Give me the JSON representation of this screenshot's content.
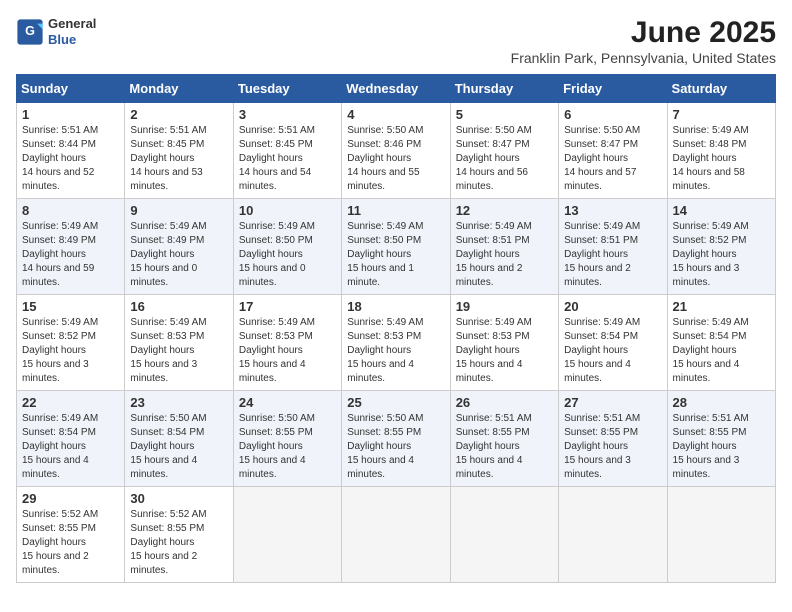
{
  "header": {
    "logo_general": "General",
    "logo_blue": "Blue",
    "month": "June 2025",
    "location": "Franklin Park, Pennsylvania, United States"
  },
  "days_of_week": [
    "Sunday",
    "Monday",
    "Tuesday",
    "Wednesday",
    "Thursday",
    "Friday",
    "Saturday"
  ],
  "weeks": [
    [
      {
        "day": "1",
        "sunrise": "5:51 AM",
        "sunset": "8:44 PM",
        "daylight": "14 hours and 52 minutes."
      },
      {
        "day": "2",
        "sunrise": "5:51 AM",
        "sunset": "8:45 PM",
        "daylight": "14 hours and 53 minutes."
      },
      {
        "day": "3",
        "sunrise": "5:51 AM",
        "sunset": "8:45 PM",
        "daylight": "14 hours and 54 minutes."
      },
      {
        "day": "4",
        "sunrise": "5:50 AM",
        "sunset": "8:46 PM",
        "daylight": "14 hours and 55 minutes."
      },
      {
        "day": "5",
        "sunrise": "5:50 AM",
        "sunset": "8:47 PM",
        "daylight": "14 hours and 56 minutes."
      },
      {
        "day": "6",
        "sunrise": "5:50 AM",
        "sunset": "8:47 PM",
        "daylight": "14 hours and 57 minutes."
      },
      {
        "day": "7",
        "sunrise": "5:49 AM",
        "sunset": "8:48 PM",
        "daylight": "14 hours and 58 minutes."
      }
    ],
    [
      {
        "day": "8",
        "sunrise": "5:49 AM",
        "sunset": "8:49 PM",
        "daylight": "14 hours and 59 minutes."
      },
      {
        "day": "9",
        "sunrise": "5:49 AM",
        "sunset": "8:49 PM",
        "daylight": "15 hours and 0 minutes."
      },
      {
        "day": "10",
        "sunrise": "5:49 AM",
        "sunset": "8:50 PM",
        "daylight": "15 hours and 0 minutes."
      },
      {
        "day": "11",
        "sunrise": "5:49 AM",
        "sunset": "8:50 PM",
        "daylight": "15 hours and 1 minute."
      },
      {
        "day": "12",
        "sunrise": "5:49 AM",
        "sunset": "8:51 PM",
        "daylight": "15 hours and 2 minutes."
      },
      {
        "day": "13",
        "sunrise": "5:49 AM",
        "sunset": "8:51 PM",
        "daylight": "15 hours and 2 minutes."
      },
      {
        "day": "14",
        "sunrise": "5:49 AM",
        "sunset": "8:52 PM",
        "daylight": "15 hours and 3 minutes."
      }
    ],
    [
      {
        "day": "15",
        "sunrise": "5:49 AM",
        "sunset": "8:52 PM",
        "daylight": "15 hours and 3 minutes."
      },
      {
        "day": "16",
        "sunrise": "5:49 AM",
        "sunset": "8:53 PM",
        "daylight": "15 hours and 3 minutes."
      },
      {
        "day": "17",
        "sunrise": "5:49 AM",
        "sunset": "8:53 PM",
        "daylight": "15 hours and 4 minutes."
      },
      {
        "day": "18",
        "sunrise": "5:49 AM",
        "sunset": "8:53 PM",
        "daylight": "15 hours and 4 minutes."
      },
      {
        "day": "19",
        "sunrise": "5:49 AM",
        "sunset": "8:53 PM",
        "daylight": "15 hours and 4 minutes."
      },
      {
        "day": "20",
        "sunrise": "5:49 AM",
        "sunset": "8:54 PM",
        "daylight": "15 hours and 4 minutes."
      },
      {
        "day": "21",
        "sunrise": "5:49 AM",
        "sunset": "8:54 PM",
        "daylight": "15 hours and 4 minutes."
      }
    ],
    [
      {
        "day": "22",
        "sunrise": "5:49 AM",
        "sunset": "8:54 PM",
        "daylight": "15 hours and 4 minutes."
      },
      {
        "day": "23",
        "sunrise": "5:50 AM",
        "sunset": "8:54 PM",
        "daylight": "15 hours and 4 minutes."
      },
      {
        "day": "24",
        "sunrise": "5:50 AM",
        "sunset": "8:55 PM",
        "daylight": "15 hours and 4 minutes."
      },
      {
        "day": "25",
        "sunrise": "5:50 AM",
        "sunset": "8:55 PM",
        "daylight": "15 hours and 4 minutes."
      },
      {
        "day": "26",
        "sunrise": "5:51 AM",
        "sunset": "8:55 PM",
        "daylight": "15 hours and 4 minutes."
      },
      {
        "day": "27",
        "sunrise": "5:51 AM",
        "sunset": "8:55 PM",
        "daylight": "15 hours and 3 minutes."
      },
      {
        "day": "28",
        "sunrise": "5:51 AM",
        "sunset": "8:55 PM",
        "daylight": "15 hours and 3 minutes."
      }
    ],
    [
      {
        "day": "29",
        "sunrise": "5:52 AM",
        "sunset": "8:55 PM",
        "daylight": "15 hours and 2 minutes."
      },
      {
        "day": "30",
        "sunrise": "5:52 AM",
        "sunset": "8:55 PM",
        "daylight": "15 hours and 2 minutes."
      },
      null,
      null,
      null,
      null,
      null
    ]
  ]
}
